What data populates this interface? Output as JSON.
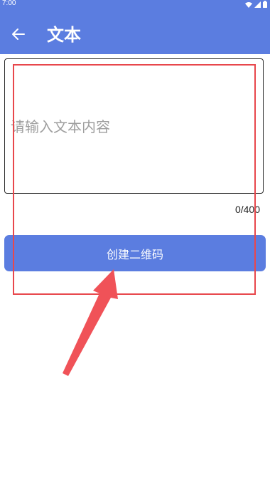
{
  "status_bar": {
    "time": "7:00",
    "icons": [
      "wifi-icon",
      "signal-icon",
      "battery-icon"
    ]
  },
  "app_bar": {
    "title": "文本",
    "back_icon": "arrow-left-icon"
  },
  "text_input": {
    "placeholder": "请输入文本内容",
    "value": "",
    "counter": "0/400"
  },
  "actions": {
    "create_label": "创建二维码"
  },
  "colors": {
    "primary": "#5b7de0",
    "annotation": "#e8474c",
    "placeholder": "#9e9e9e"
  }
}
